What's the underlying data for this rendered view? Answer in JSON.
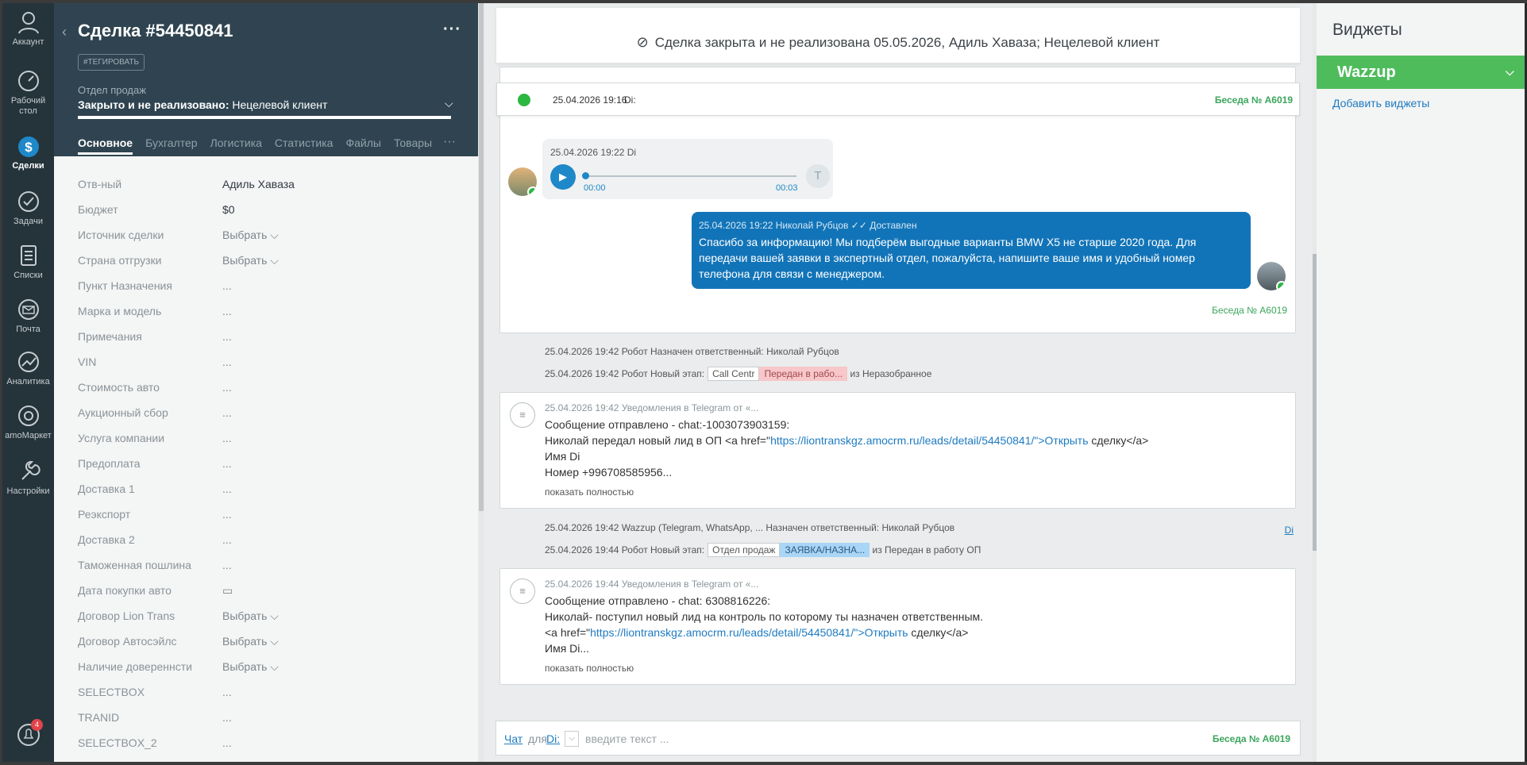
{
  "nav": {
    "items": [
      {
        "label": "Аккаунт",
        "icon": "account-icon"
      },
      {
        "label": "Рабочий стол",
        "icon": "dashboard-icon"
      },
      {
        "label": "Сделки",
        "icon": "deals-icon",
        "active": true
      },
      {
        "label": "Задачи",
        "icon": "tasks-icon"
      },
      {
        "label": "Списки",
        "icon": "lists-icon"
      },
      {
        "label": "Почта",
        "icon": "mail-icon"
      },
      {
        "label": "Аналитика",
        "icon": "analytics-icon"
      },
      {
        "label": "amoМаркет",
        "icon": "market-icon"
      },
      {
        "label": "Настройки",
        "icon": "settings-icon"
      }
    ],
    "notifications_count": "4"
  },
  "deal": {
    "title": "Сделка #54450841",
    "tag_button": "#ТЕГИРОВАТЬ",
    "pipeline_label": "Отдел продаж",
    "status_bold": "Закрыто и не реализовано:",
    "status_reason": " Нецелевой клиент",
    "tabs": [
      "Основное",
      "Бухгалтер",
      "Логистика",
      "Статистика",
      "Файлы",
      "Товары"
    ],
    "fields": [
      {
        "k": "Отв-ный",
        "v": "Адиль Хаваза"
      },
      {
        "k": "Бюджет",
        "v": "$0"
      },
      {
        "k": "Источник сделки",
        "v": "Выбрать ⌵"
      },
      {
        "k": "Страна отгрузки",
        "v": "Выбрать ⌵"
      },
      {
        "k": "Пункт Назначения",
        "v": "..."
      },
      {
        "k": "Марка и модель",
        "v": "..."
      },
      {
        "k": "Примечания",
        "v": "..."
      },
      {
        "k": "VIN",
        "v": "..."
      },
      {
        "k": "Стоимость авто",
        "v": "..."
      },
      {
        "k": "Аукционный сбор",
        "v": "..."
      },
      {
        "k": "Услуга компании",
        "v": "..."
      },
      {
        "k": "Предоплата",
        "v": "..."
      },
      {
        "k": "Доставка 1",
        "v": "..."
      },
      {
        "k": "Реэкспорт",
        "v": "..."
      },
      {
        "k": "Доставка 2",
        "v": "..."
      },
      {
        "k": "Таможенная пошлина",
        "v": "..."
      },
      {
        "k": "Дата покупки авто",
        "v": "▭"
      },
      {
        "k": "Договор Lion Trans",
        "v": "Выбрать ⌵"
      },
      {
        "k": "Договор Автосэйлс",
        "v": "Выбрать ⌵"
      },
      {
        "k": "Наличие довереннсти",
        "v": "Выбрать ⌵"
      },
      {
        "k": "SELECTBOX",
        "v": "..."
      },
      {
        "k": "TRANID",
        "v": "..."
      },
      {
        "k": "SELECTBOX_2",
        "v": "..."
      }
    ]
  },
  "feed": {
    "closed_banner": "Сделка закрыта и не реализована 05.05.2026, Адиль Хаваза; Нецелевой клиент",
    "wa_strip": {
      "date": "25.04.2026 19:16",
      "who": "Di:",
      "chat": "Беседа № А6019"
    },
    "voice": {
      "meta": "25.04.2026 19:22 Di",
      "start": "00:00",
      "end": "00:03",
      "transcribe": "T"
    },
    "reply": {
      "meta": "25.04.2026 19:22 Николай Рубцов ✓✓ Доставлен",
      "text": "Спасибо за информацию! Мы подберём выгодные варианты BMW X5 не старше 2020 года. Для передачи вашей заявки в экспертный отдел, пожалуйста, напишите ваше имя и удобный номер телефона для связи с менеджером."
    },
    "conv_chat_id": "Беседа № А6019",
    "sys1": "25.04.2026 19:42 Робот Назначен ответственный: Николай Рубцов",
    "sys2": {
      "prefix": "25.04.2026 19:42 Робот Новый этап:",
      "from": "Call Centr",
      "stage": "Передан в рабо...",
      "suffix": " из Неразобранное"
    },
    "note1": {
      "meta": "25.04.2026 19:42 Уведомления в Telegram от «...",
      "l1": "Сообщение отправлено - chat:-1003073903159:",
      "l2a": "Николай передал новый лид в ОП <a href=\"",
      "link": "https://liontranskgz.amocrm.ru/leads/detail/54450841/\">Открыть",
      "l2b": " сделку</a>",
      "l3": "Имя Di",
      "l4": "Номер +996708585956...",
      "more": "показать полностью"
    },
    "sys3": "25.04.2026 19:42 Wazzup (Telegram, WhatsApp, ... Назначен ответственный: Николай Рубцов",
    "sys3_link": "Di",
    "sys4": {
      "prefix": "25.04.2026 19:44 Робот Новый этап:",
      "from": "Отдел продаж",
      "stage": "ЗАЯВКА/НАЗНА...",
      "suffix": " из Передан в работу ОП"
    },
    "note2": {
      "meta": "25.04.2026 19:44 Уведомления в Telegram от «...",
      "l1": "Сообщение отправлено - chat: 6308816226:",
      "l2": "Николай- поступил новый лид на контроль по которому ты назначен ответственным.",
      "l3a": "<a href=\"",
      "link": "https://liontranskgz.amocrm.ru/leads/detail/54450841/\">Открыть",
      "l3b": " сделку</a>",
      "l4": "Имя Di...",
      "more": "показать полностью"
    },
    "input": {
      "chat": "Чат",
      "for": "для",
      "to": "Di:",
      "placeholder": "введите текст ...",
      "conv": "Беседа № А6019"
    }
  },
  "widgets": {
    "title": "Виджеты",
    "wazzup": "Wazzup",
    "add": "Добавить виджеты"
  }
}
